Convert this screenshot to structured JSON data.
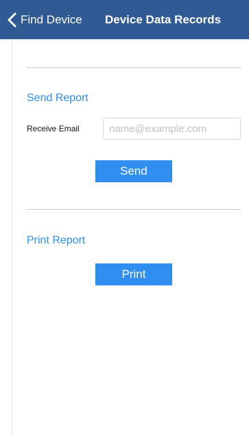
{
  "navbar": {
    "back_label": "Find Device",
    "title": "Device Data Records",
    "back_icon": "chevron-left-icon",
    "background_color": "#2f5a93"
  },
  "send_report": {
    "title": "Send Report",
    "email_label": "Receive Email",
    "email_value": "",
    "email_placeholder": "name@example.com",
    "button_label": "Send"
  },
  "print_report": {
    "title": "Print Report",
    "button_label": "Print"
  },
  "colors": {
    "accent": "#2f8ef0",
    "divider": "#c9c9c9"
  }
}
